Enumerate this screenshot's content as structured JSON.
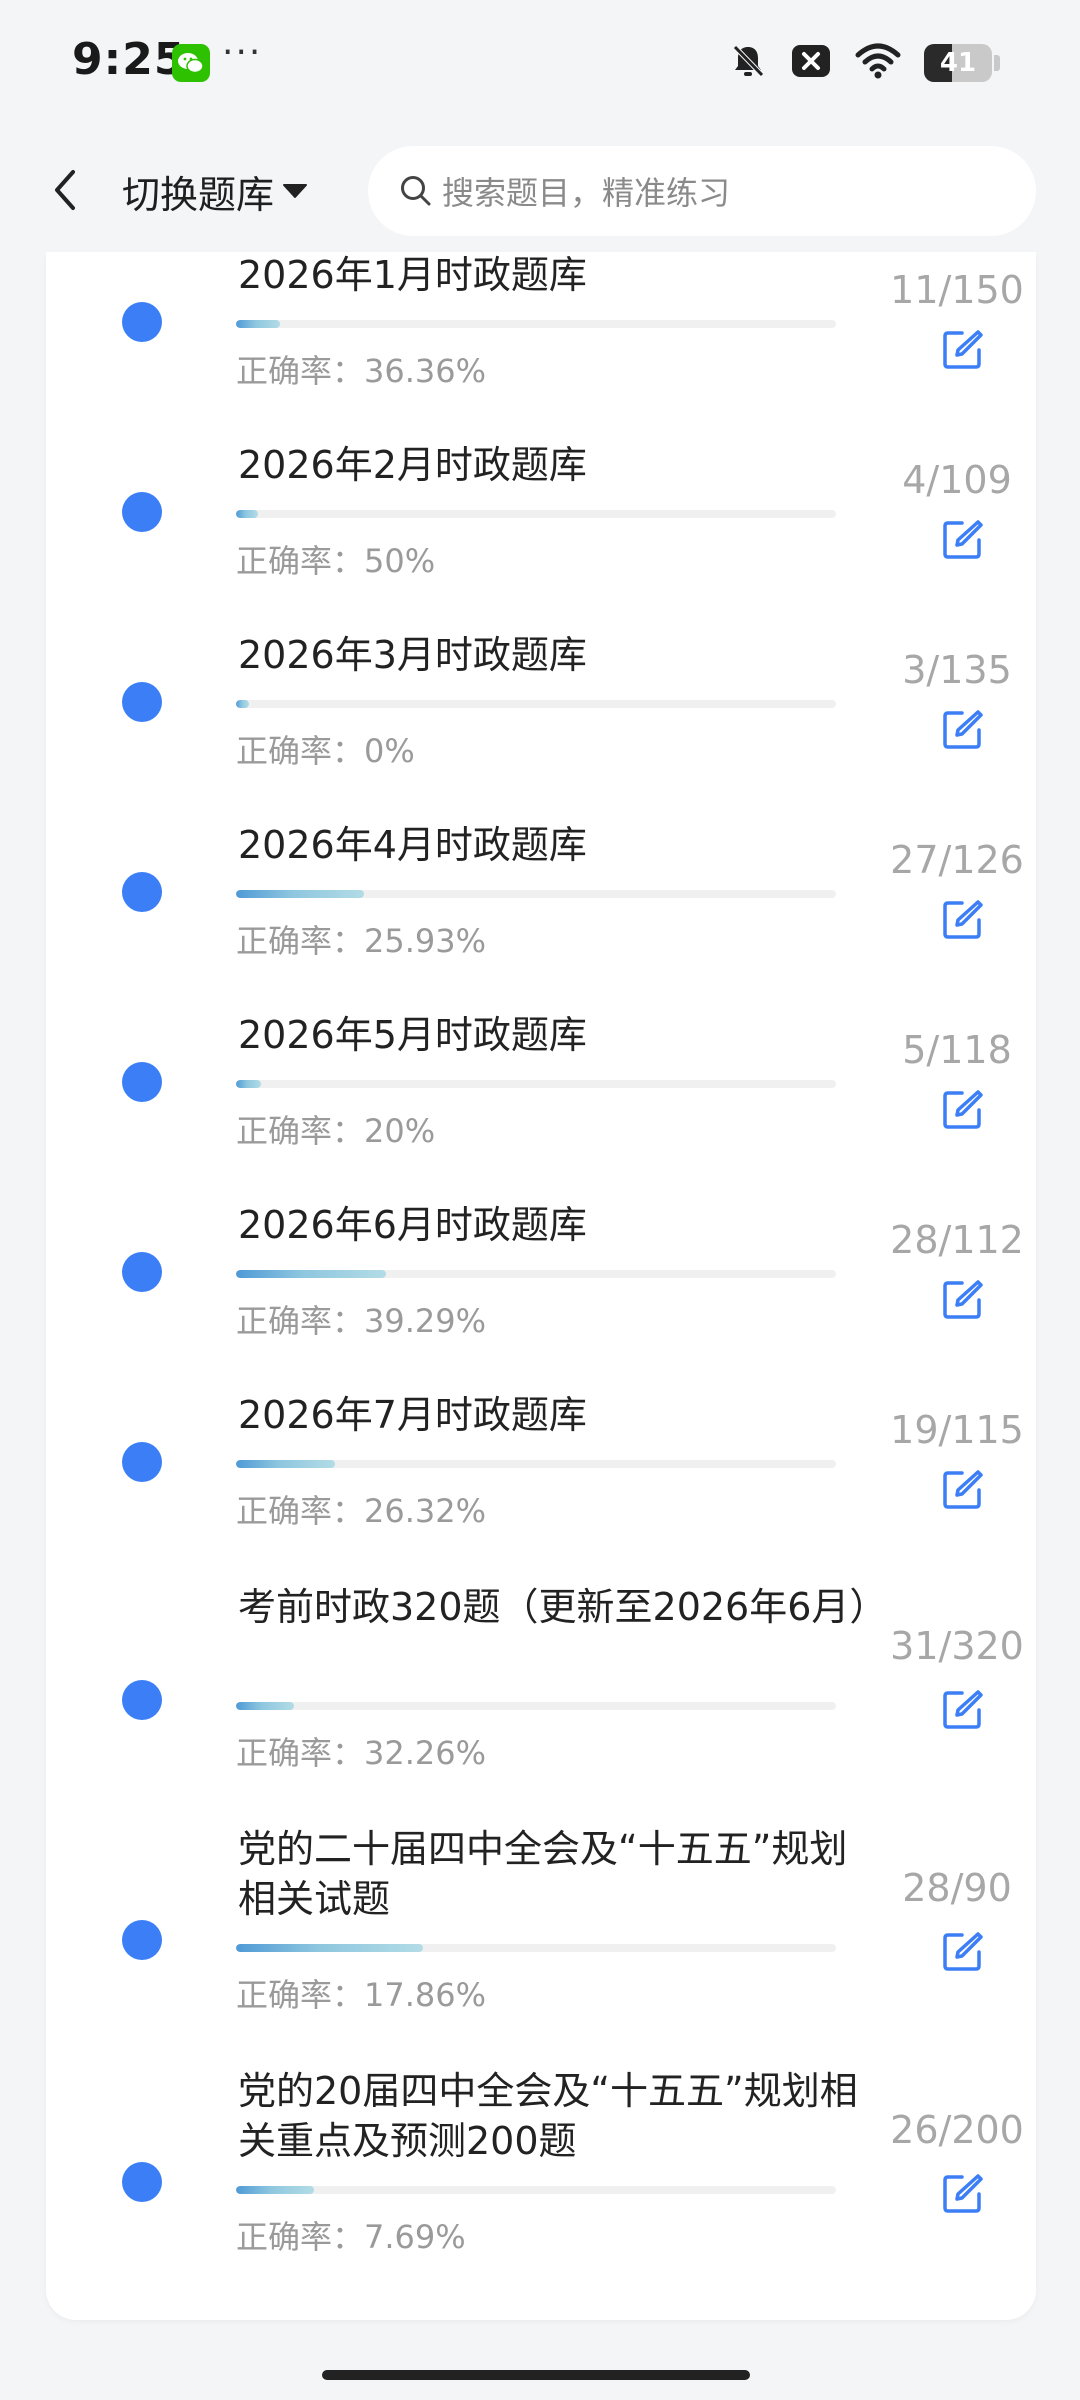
{
  "status_bar": {
    "time": "9:25",
    "more": "···",
    "battery_level": "41",
    "battery_percent": 41
  },
  "header": {
    "switch_label": "切换题库",
    "search_placeholder": "搜索题目，精准练习"
  },
  "items": [
    {
      "title": "2026年1月时政题库",
      "accuracy": "正确率：36.36%",
      "count": "11/150",
      "progress": 0.073
    },
    {
      "title": "2026年2月时政题库",
      "accuracy": "正确率：50%",
      "count": "4/109",
      "progress": 0.037
    },
    {
      "title": "2026年3月时政题库",
      "accuracy": "正确率：0%",
      "count": "3/135",
      "progress": 0.022
    },
    {
      "title": "2026年4月时政题库",
      "accuracy": "正确率：25.93%",
      "count": "27/126",
      "progress": 0.214
    },
    {
      "title": "2026年5月时政题库",
      "accuracy": "正确率：20%",
      "count": "5/118",
      "progress": 0.042
    },
    {
      "title": "2026年6月时政题库",
      "accuracy": "正确率：39.29%",
      "count": "28/112",
      "progress": 0.25
    },
    {
      "title": "2026年7月时政题库",
      "accuracy": "正确率：26.32%",
      "count": "19/115",
      "progress": 0.165
    },
    {
      "title": "考前时政320题（更新至2026年6月）",
      "accuracy": "正确率：32.26%",
      "count": "31/320",
      "progress": 0.097
    },
    {
      "title": "党的二十届四中全会及“十五五”规划相关试题",
      "accuracy": "正确率：17.86%",
      "count": "28/90",
      "progress": 0.311
    },
    {
      "title": "党的20届四中全会及“十五五”规划相关重点及预测200题",
      "accuracy": "正确率：7.69%",
      "count": "26/200",
      "progress": 0.13
    }
  ],
  "colors": {
    "accent": "#3b7ef6",
    "progress_start": "#4f9ad6",
    "progress_end": "#b2dce6",
    "muted_text": "#9a9a9a"
  }
}
